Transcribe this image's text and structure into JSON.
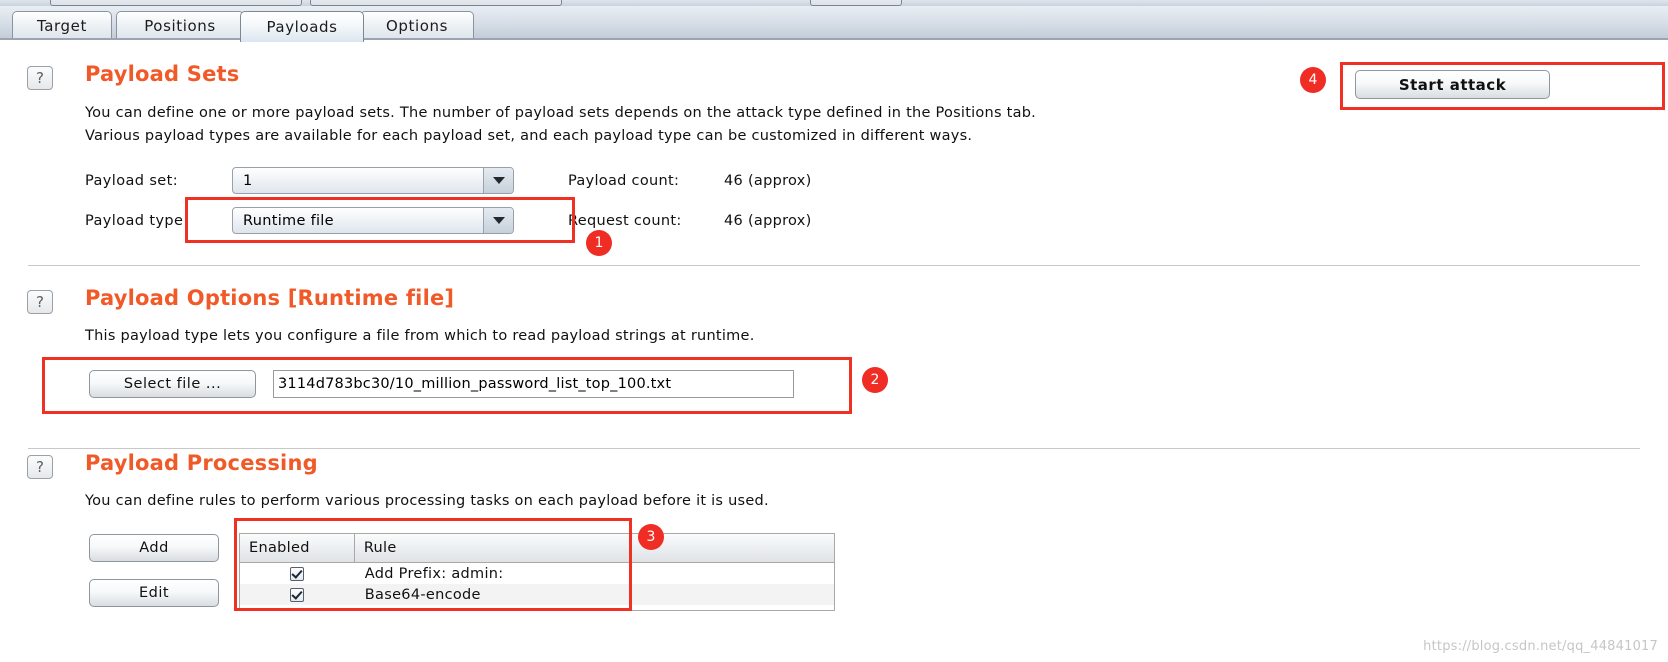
{
  "window": {
    "tabs": [
      {
        "label": "Target",
        "selected": false
      },
      {
        "label": "Positions",
        "selected": false
      },
      {
        "label": "Payloads",
        "selected": true
      },
      {
        "label": "Options",
        "selected": false
      }
    ]
  },
  "payload_sets": {
    "help_icon": "question-mark-icon",
    "title": "Payload Sets",
    "desc_line1": "You can define one or more payload sets. The number of payload sets depends on the attack type defined in the Positions tab.",
    "desc_line2": "Various payload types are available for each payload set, and each payload type can be customized in different ways.",
    "payload_set_label": "Payload set:",
    "payload_set_value": "1",
    "payload_type_label": "Payload type:",
    "payload_type_value": "Runtime file",
    "payload_count_label": "Payload count:",
    "payload_count_value": "46 (approx)",
    "request_count_label": "Request count:",
    "request_count_value": "46 (approx)",
    "start_attack_label": "Start attack"
  },
  "payload_options": {
    "help_icon": "question-mark-icon",
    "title": "Payload Options [Runtime file]",
    "desc": "This payload type lets you configure a file from which to read payload strings at runtime.",
    "select_file_label": "Select file ...",
    "file_path_value": "3114d783bc30/10_million_password_list_top_100.txt"
  },
  "payload_processing": {
    "help_icon": "question-mark-icon",
    "title": "Payload Processing",
    "desc": "You can define rules to perform various processing tasks on each payload before it is used.",
    "add_label": "Add",
    "edit_label": "Edit",
    "columns": [
      "Enabled",
      "Rule"
    ],
    "rows": [
      {
        "enabled": true,
        "rule": "Add Prefix: admin:"
      },
      {
        "enabled": true,
        "rule": "Base64-encode"
      }
    ]
  },
  "annotations": {
    "badge1": "1",
    "badge2": "2",
    "badge3": "3",
    "badge4": "4",
    "accent_color": "#ef2d24"
  },
  "watermark": "https://blog.csdn.net/qq_44841017"
}
